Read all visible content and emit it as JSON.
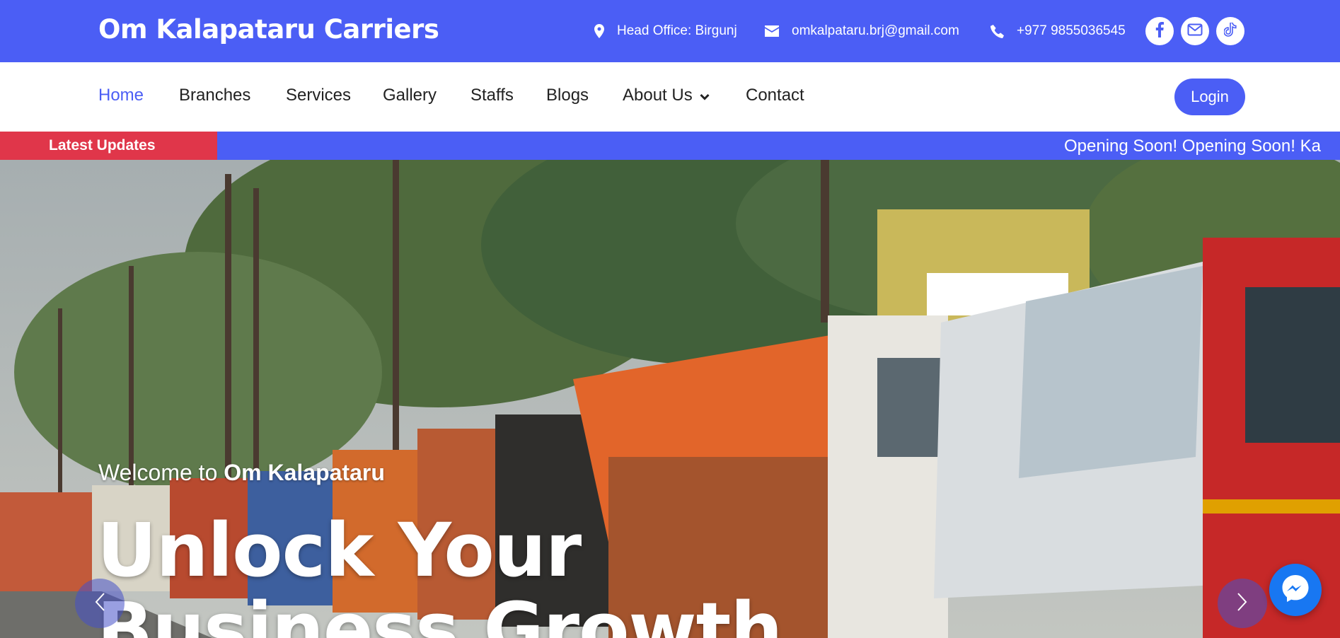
{
  "header": {
    "brand": "Om Kalapataru Carriers",
    "office": "Head Office: Birgunj",
    "email": "omkalpataru.brj@gmail.com",
    "phone": "+977 9855036545",
    "social_icons": [
      "facebook-icon",
      "mail-icon",
      "tiktok-icon"
    ]
  },
  "nav": {
    "items": [
      {
        "label": "Home",
        "active": true
      },
      {
        "label": "Branches"
      },
      {
        "label": "Services"
      },
      {
        "label": "Gallery"
      },
      {
        "label": "Staffs"
      },
      {
        "label": "Blogs"
      },
      {
        "label": "About Us",
        "dropdown": true
      },
      {
        "label": "Contact"
      }
    ],
    "login_label": "Login"
  },
  "ticker": {
    "label": "Latest Updates",
    "text": "Opening Soon! Opening Soon!   Ka"
  },
  "hero": {
    "welcome_prefix": "Welcome to ",
    "welcome_strong": "Om Kalapataru",
    "heading": "Unlock Your Business Growth"
  },
  "colors": {
    "primary": "#4b5ef5",
    "ticker_label_bg": "#e0364a",
    "messenger": "#1877f2"
  }
}
